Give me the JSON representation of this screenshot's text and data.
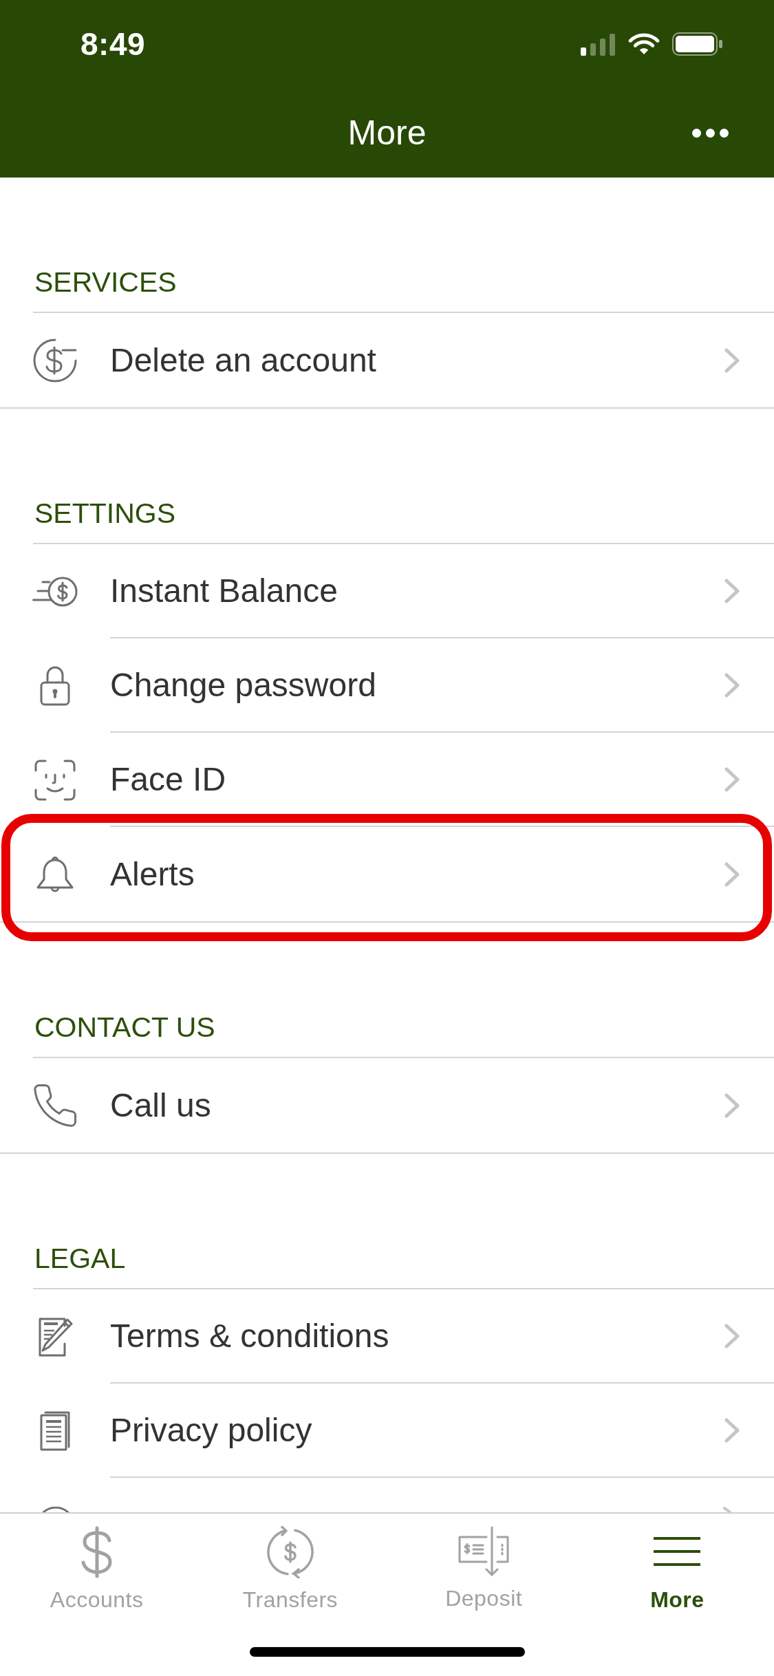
{
  "status_bar": {
    "time": "8:49"
  },
  "nav_bar": {
    "title": "More"
  },
  "sections": [
    {
      "heading": "SERVICES",
      "items": [
        {
          "label": "Delete an account",
          "highlighted": false
        }
      ]
    },
    {
      "heading": "SETTINGS",
      "items": [
        {
          "label": "Instant Balance",
          "highlighted": false
        },
        {
          "label": "Change password",
          "highlighted": false
        },
        {
          "label": "Face ID",
          "highlighted": false
        },
        {
          "label": "Alerts",
          "highlighted": true
        }
      ]
    },
    {
      "heading": "CONTACT US",
      "items": [
        {
          "label": "Call us",
          "highlighted": false
        }
      ]
    },
    {
      "heading": "LEGAL",
      "items": [
        {
          "label": "Terms & conditions",
          "highlighted": false
        },
        {
          "label": "Privacy policy",
          "highlighted": false
        }
      ]
    }
  ],
  "tab_bar": [
    {
      "label": "Accounts",
      "selected": false
    },
    {
      "label": "Transfers",
      "selected": false
    },
    {
      "label": "Deposit",
      "selected": false
    },
    {
      "label": "More",
      "selected": true
    }
  ]
}
